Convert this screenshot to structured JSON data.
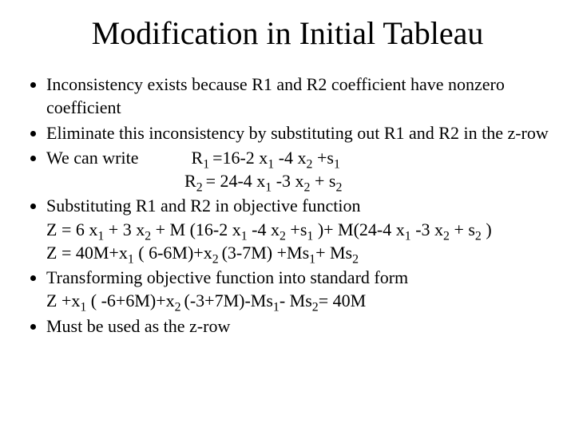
{
  "title": "Modification in Initial Tableau",
  "bullets": {
    "b1": "Inconsistency exists because R1 and R2 coefficient have nonzero coefficient",
    "b2": "Eliminate this inconsistency by substituting out R1 and R2 in the z-row",
    "b3_lead": "We can write",
    "b3_eq1_pre": "R",
    "b3_eq1_sub": "1 ",
    "b3_eq1_post": "=16-2 x",
    "b3_eq1_x1s": "1",
    "b3_eq1_mid": " -4 x",
    "b3_eq1_x2s": "2",
    "b3_eq1_tail": " +s",
    "b3_eq1_s1s": "1",
    "b3_eq2_pre": "R",
    "b3_eq2_sub": "2 ",
    "b3_eq2_post": "= 24-4 x",
    "b3_eq2_x1s": "1",
    "b3_eq2_mid": " -3 x",
    "b3_eq2_x2s": "2",
    "b3_eq2_tail": " + s",
    "b3_eq2_s2s": "2",
    "b4_lead": "Substituting R1 and R2 in objective function",
    "b4_z1_a": "Z = 6 x",
    "b4_z1_s1": "1",
    "b4_z1_b": " + 3 x",
    "b4_z1_s2": "2",
    "b4_z1_c": " + M (16-2 x",
    "b4_z1_s3": "1",
    "b4_z1_d": " -4 x",
    "b4_z1_s4": "2",
    "b4_z1_e": " +s",
    "b4_z1_s5": "1",
    "b4_z1_f": " )+ M(24-4 x",
    "b4_z1_s6": "1",
    "b4_z1_g": " -3 x",
    "b4_z1_s7": "2",
    "b4_z1_h": " + s",
    "b4_z1_s8": "2",
    "b4_z1_i": " )",
    "b4_z2_a": "Z = 40M+x",
    "b4_z2_s1": "1",
    "b4_z2_b": " ( 6-6M)+x",
    "b4_z2_s2": "2 ",
    "b4_z2_c": "(3-7M) +Ms",
    "b4_z2_s3": "1",
    "b4_z2_d": "+ Ms",
    "b4_z2_s4": "2",
    "b5_lead": "Transforming objective function into standard form",
    "b5_eq_a": "Z +x",
    "b5_eq_s1": "1",
    "b5_eq_b": " ( -6+6M)+x",
    "b5_eq_s2": "2 ",
    "b5_eq_c": "(-3+7M)-Ms",
    "b5_eq_s3": "1",
    "b5_eq_d": "- Ms",
    "b5_eq_s4": "2",
    "b5_eq_e": "= 40M",
    "b6": "Must be used as the z-row"
  }
}
